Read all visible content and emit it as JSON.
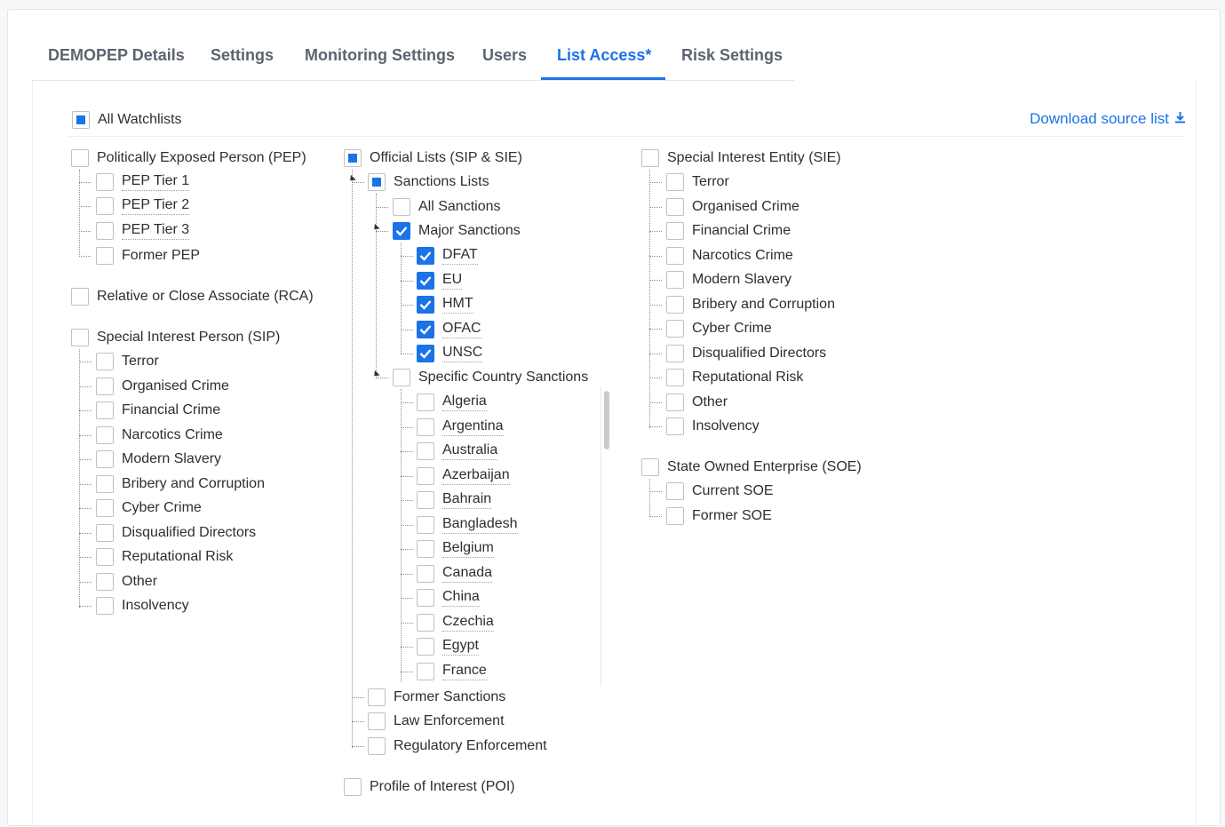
{
  "tabs": [
    {
      "label": "DEMOPEP Details"
    },
    {
      "label": "Settings"
    },
    {
      "label": "Monitoring Settings"
    },
    {
      "label": "Users"
    },
    {
      "label": "List Access*"
    },
    {
      "label": "Risk Settings"
    }
  ],
  "header": {
    "all_watchlists": "All Watchlists",
    "download_label": "Download source list"
  },
  "pep": {
    "label": "Politically Exposed Person (PEP)",
    "items": [
      "PEP Tier 1",
      "PEP Tier 2",
      "PEP Tier 3",
      "Former PEP"
    ]
  },
  "rca": {
    "label": "Relative or Close Associate (RCA)"
  },
  "sip": {
    "label": "Special Interest Person (SIP)",
    "items": [
      "Terror",
      "Organised Crime",
      "Financial Crime",
      "Narcotics Crime",
      "Modern Slavery",
      "Bribery and Corruption",
      "Cyber Crime",
      "Disqualified Directors",
      "Reputational Risk",
      "Other",
      "Insolvency"
    ]
  },
  "official": {
    "label": "Official Lists (SIP & SIE)",
    "sanctions_lists": "Sanctions Lists",
    "all_sanctions": "All Sanctions",
    "major_sanctions": "Major Sanctions",
    "major_items": [
      "DFAT",
      "EU",
      "HMT",
      "OFAC",
      "UNSC"
    ],
    "specific_country": "Specific Country Sanctions",
    "countries": [
      "Algeria",
      "Argentina",
      "Australia",
      "Azerbaijan",
      "Bahrain",
      "Bangladesh",
      "Belgium",
      "Canada",
      "China",
      "Czechia",
      "Egypt",
      "France"
    ],
    "former_sanctions": "Former Sanctions",
    "law_enforcement": "Law Enforcement",
    "regulatory_enforcement": "Regulatory Enforcement"
  },
  "poi": {
    "label": "Profile of Interest (POI)"
  },
  "sie": {
    "label": "Special Interest Entity (SIE)",
    "items": [
      "Terror",
      "Organised Crime",
      "Financial Crime",
      "Narcotics Crime",
      "Modern Slavery",
      "Bribery and Corruption",
      "Cyber Crime",
      "Disqualified Directors",
      "Reputational Risk",
      "Other",
      "Insolvency"
    ]
  },
  "soe": {
    "label": "State Owned Enterprise (SOE)",
    "items": [
      "Current SOE",
      "Former SOE"
    ]
  },
  "colors": {
    "accent": "#1a73e8",
    "tab_inactive": "#5b6470"
  }
}
